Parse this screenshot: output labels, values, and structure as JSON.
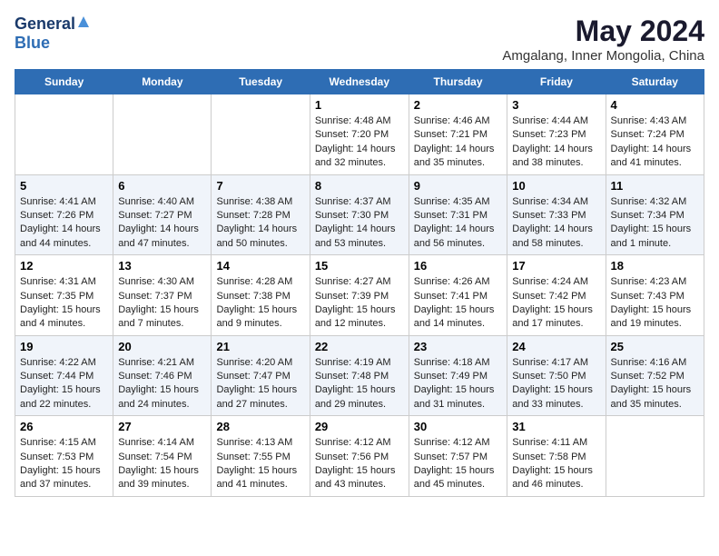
{
  "header": {
    "logo_general": "General",
    "logo_blue": "Blue",
    "title": "May 2024",
    "subtitle": "Amgalang, Inner Mongolia, China"
  },
  "days_of_week": [
    "Sunday",
    "Monday",
    "Tuesday",
    "Wednesday",
    "Thursday",
    "Friday",
    "Saturday"
  ],
  "weeks": [
    [
      {
        "day": "",
        "info": ""
      },
      {
        "day": "",
        "info": ""
      },
      {
        "day": "",
        "info": ""
      },
      {
        "day": "1",
        "info": "Sunrise: 4:48 AM\nSunset: 7:20 PM\nDaylight: 14 hours\nand 32 minutes."
      },
      {
        "day": "2",
        "info": "Sunrise: 4:46 AM\nSunset: 7:21 PM\nDaylight: 14 hours\nand 35 minutes."
      },
      {
        "day": "3",
        "info": "Sunrise: 4:44 AM\nSunset: 7:23 PM\nDaylight: 14 hours\nand 38 minutes."
      },
      {
        "day": "4",
        "info": "Sunrise: 4:43 AM\nSunset: 7:24 PM\nDaylight: 14 hours\nand 41 minutes."
      }
    ],
    [
      {
        "day": "5",
        "info": "Sunrise: 4:41 AM\nSunset: 7:26 PM\nDaylight: 14 hours\nand 44 minutes."
      },
      {
        "day": "6",
        "info": "Sunrise: 4:40 AM\nSunset: 7:27 PM\nDaylight: 14 hours\nand 47 minutes."
      },
      {
        "day": "7",
        "info": "Sunrise: 4:38 AM\nSunset: 7:28 PM\nDaylight: 14 hours\nand 50 minutes."
      },
      {
        "day": "8",
        "info": "Sunrise: 4:37 AM\nSunset: 7:30 PM\nDaylight: 14 hours\nand 53 minutes."
      },
      {
        "day": "9",
        "info": "Sunrise: 4:35 AM\nSunset: 7:31 PM\nDaylight: 14 hours\nand 56 minutes."
      },
      {
        "day": "10",
        "info": "Sunrise: 4:34 AM\nSunset: 7:33 PM\nDaylight: 14 hours\nand 58 minutes."
      },
      {
        "day": "11",
        "info": "Sunrise: 4:32 AM\nSunset: 7:34 PM\nDaylight: 15 hours\nand 1 minute."
      }
    ],
    [
      {
        "day": "12",
        "info": "Sunrise: 4:31 AM\nSunset: 7:35 PM\nDaylight: 15 hours\nand 4 minutes."
      },
      {
        "day": "13",
        "info": "Sunrise: 4:30 AM\nSunset: 7:37 PM\nDaylight: 15 hours\nand 7 minutes."
      },
      {
        "day": "14",
        "info": "Sunrise: 4:28 AM\nSunset: 7:38 PM\nDaylight: 15 hours\nand 9 minutes."
      },
      {
        "day": "15",
        "info": "Sunrise: 4:27 AM\nSunset: 7:39 PM\nDaylight: 15 hours\nand 12 minutes."
      },
      {
        "day": "16",
        "info": "Sunrise: 4:26 AM\nSunset: 7:41 PM\nDaylight: 15 hours\nand 14 minutes."
      },
      {
        "day": "17",
        "info": "Sunrise: 4:24 AM\nSunset: 7:42 PM\nDaylight: 15 hours\nand 17 minutes."
      },
      {
        "day": "18",
        "info": "Sunrise: 4:23 AM\nSunset: 7:43 PM\nDaylight: 15 hours\nand 19 minutes."
      }
    ],
    [
      {
        "day": "19",
        "info": "Sunrise: 4:22 AM\nSunset: 7:44 PM\nDaylight: 15 hours\nand 22 minutes."
      },
      {
        "day": "20",
        "info": "Sunrise: 4:21 AM\nSunset: 7:46 PM\nDaylight: 15 hours\nand 24 minutes."
      },
      {
        "day": "21",
        "info": "Sunrise: 4:20 AM\nSunset: 7:47 PM\nDaylight: 15 hours\nand 27 minutes."
      },
      {
        "day": "22",
        "info": "Sunrise: 4:19 AM\nSunset: 7:48 PM\nDaylight: 15 hours\nand 29 minutes."
      },
      {
        "day": "23",
        "info": "Sunrise: 4:18 AM\nSunset: 7:49 PM\nDaylight: 15 hours\nand 31 minutes."
      },
      {
        "day": "24",
        "info": "Sunrise: 4:17 AM\nSunset: 7:50 PM\nDaylight: 15 hours\nand 33 minutes."
      },
      {
        "day": "25",
        "info": "Sunrise: 4:16 AM\nSunset: 7:52 PM\nDaylight: 15 hours\nand 35 minutes."
      }
    ],
    [
      {
        "day": "26",
        "info": "Sunrise: 4:15 AM\nSunset: 7:53 PM\nDaylight: 15 hours\nand 37 minutes."
      },
      {
        "day": "27",
        "info": "Sunrise: 4:14 AM\nSunset: 7:54 PM\nDaylight: 15 hours\nand 39 minutes."
      },
      {
        "day": "28",
        "info": "Sunrise: 4:13 AM\nSunset: 7:55 PM\nDaylight: 15 hours\nand 41 minutes."
      },
      {
        "day": "29",
        "info": "Sunrise: 4:12 AM\nSunset: 7:56 PM\nDaylight: 15 hours\nand 43 minutes."
      },
      {
        "day": "30",
        "info": "Sunrise: 4:12 AM\nSunset: 7:57 PM\nDaylight: 15 hours\nand 45 minutes."
      },
      {
        "day": "31",
        "info": "Sunrise: 4:11 AM\nSunset: 7:58 PM\nDaylight: 15 hours\nand 46 minutes."
      },
      {
        "day": "",
        "info": ""
      }
    ]
  ]
}
